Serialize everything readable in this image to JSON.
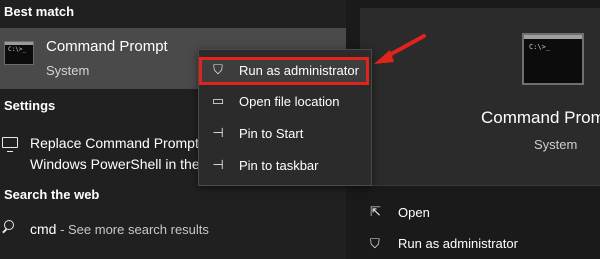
{
  "sections": {
    "best_match": "Best match",
    "settings": "Settings",
    "search_web": "Search the web"
  },
  "best_match": {
    "name": "Command Prompt",
    "type": "System",
    "thumb_prompt": "C:\\>_"
  },
  "settings_item": {
    "line1": "Replace Command Prompt",
    "line2": "Windows PowerShell in the"
  },
  "web_search": {
    "query": "cmd",
    "hint": " - See more search results"
  },
  "context_menu": {
    "items": [
      {
        "label": "Run as administrator",
        "icon": "shield-icon",
        "highlighted": true
      },
      {
        "label": "Open file location",
        "icon": "folder-icon"
      },
      {
        "label": "Pin to Start",
        "icon": "pin-icon"
      },
      {
        "label": "Pin to taskbar",
        "icon": "pin-icon"
      }
    ]
  },
  "right_panel": {
    "title": "Command Prompt",
    "subtitle": "System",
    "actions": [
      {
        "label": "Open",
        "icon": "open-icon"
      },
      {
        "label": "Run as administrator",
        "icon": "shield-icon"
      }
    ]
  },
  "colors": {
    "highlight_border": "#e0241b",
    "arrow": "#e0241b"
  }
}
